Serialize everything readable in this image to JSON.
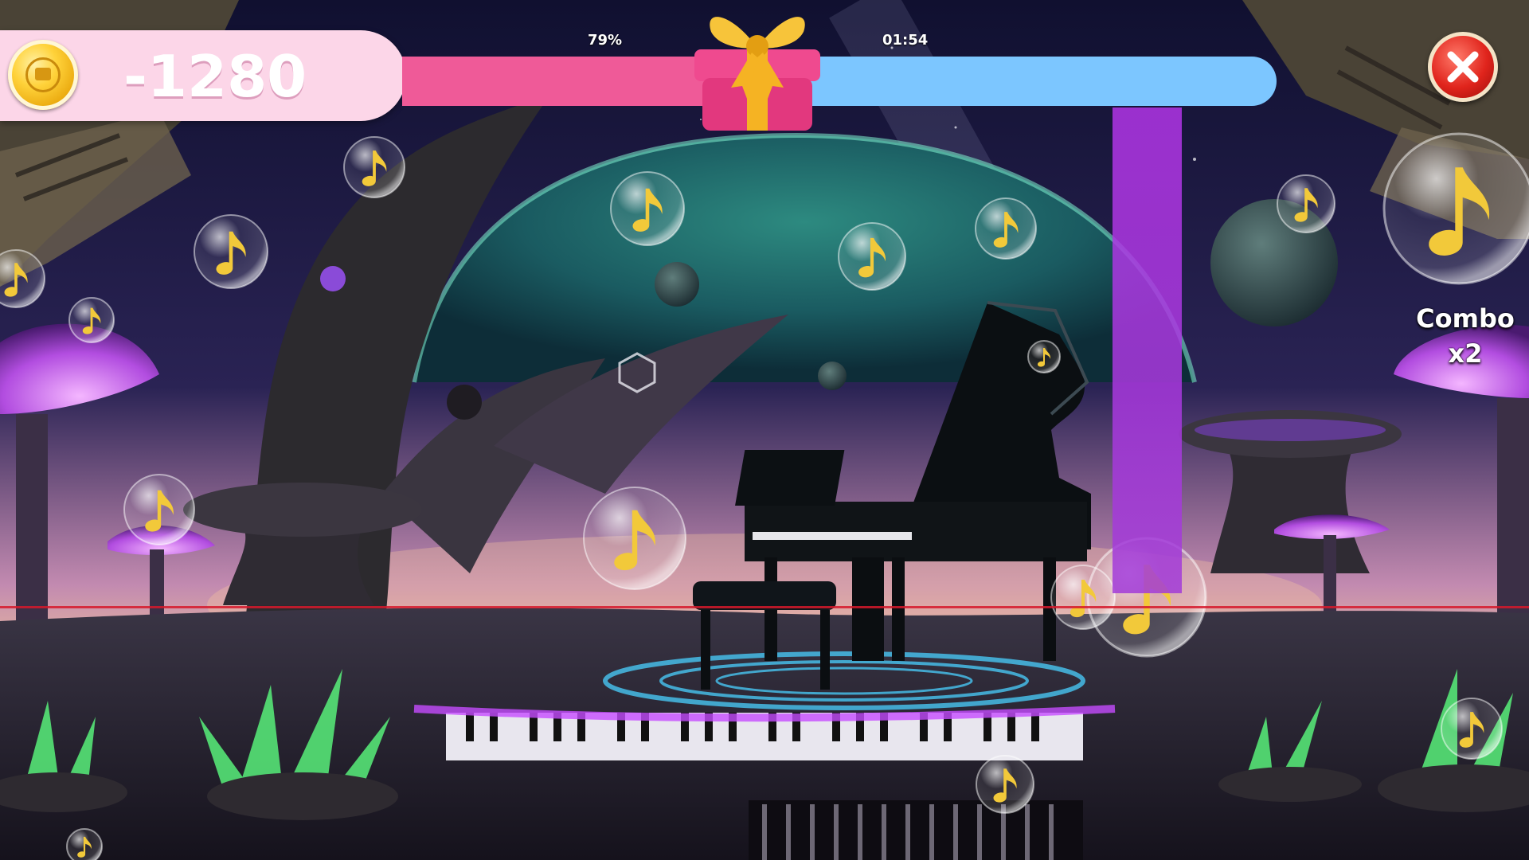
{
  "hud": {
    "score": "-1280",
    "progress_percent_label": "79%",
    "progress_fraction": 0.4,
    "time_label": "01:54"
  },
  "combo": {
    "label": "Combo",
    "multiplier": "x2"
  },
  "icons": {
    "coin": "coin-icon",
    "gift": "gift-box-icon",
    "close": "close-x-icon",
    "note": "music-note-icon"
  },
  "colors": {
    "score_panel": "#fcd6e8",
    "progress_fill": "#ef5a98",
    "progress_track": "#7cc6ff",
    "note_lane": "#b235e8",
    "hit_line": "#d6192b",
    "close_button": "#e0241c",
    "gift_box": "#ef4a8f",
    "gift_ribbon": "#f5b323"
  }
}
